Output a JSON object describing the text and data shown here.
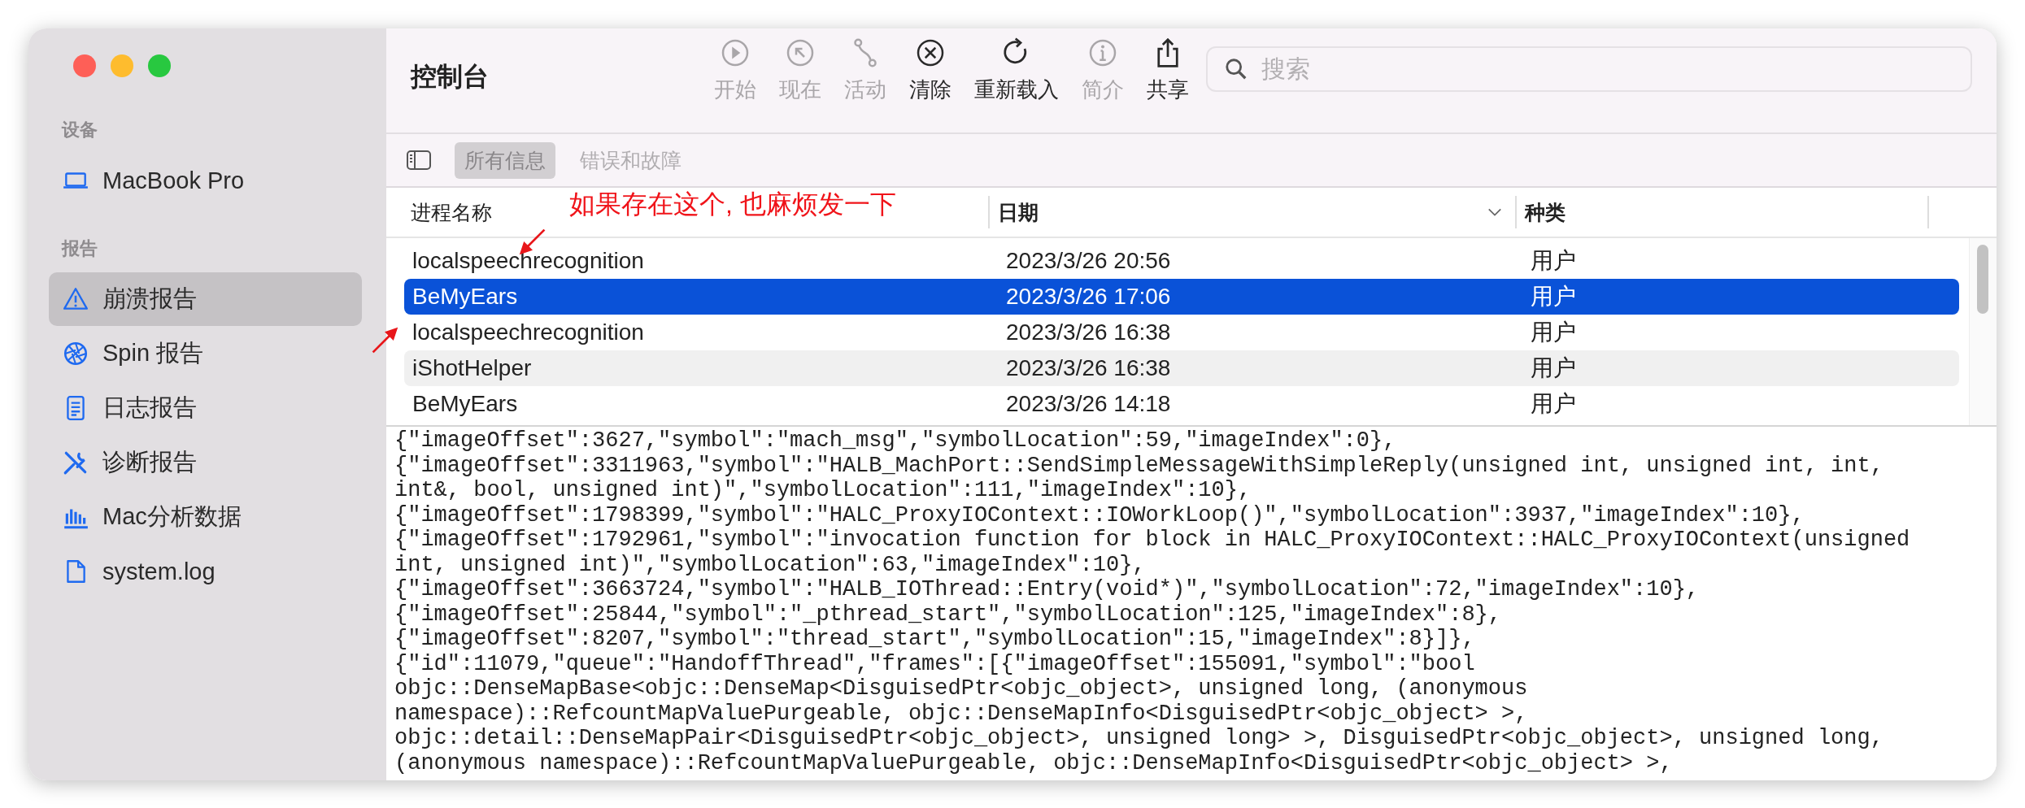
{
  "window": {
    "title": "控制台"
  },
  "sidebar": {
    "sections": [
      {
        "heading": "设备",
        "items": [
          {
            "label": "MacBook Pro",
            "kind": "laptop",
            "selected": false
          }
        ]
      },
      {
        "heading": "报告",
        "items": [
          {
            "label": "崩溃报告",
            "kind": "warning",
            "selected": true
          },
          {
            "label": "Spin 报告",
            "kind": "spin",
            "selected": false
          },
          {
            "label": "日志报告",
            "kind": "document",
            "selected": false
          },
          {
            "label": "诊断报告",
            "kind": "tools",
            "selected": false
          },
          {
            "label": "Mac分析数据",
            "kind": "chart",
            "selected": false
          },
          {
            "label": "system.log",
            "kind": "file",
            "selected": false
          }
        ]
      }
    ]
  },
  "toolbar": {
    "buttons": [
      {
        "label": "开始",
        "kind": "play",
        "disabled": true
      },
      {
        "label": "现在",
        "kind": "now",
        "disabled": true
      },
      {
        "label": "活动",
        "kind": "activity",
        "disabled": true
      },
      {
        "label": "清除",
        "kind": "clear",
        "disabled": false
      },
      {
        "label": "重新载入",
        "kind": "reload",
        "disabled": false
      },
      {
        "label": "简介",
        "kind": "info",
        "disabled": true
      },
      {
        "label": "共享",
        "kind": "share",
        "disabled": false
      }
    ],
    "search": {
      "placeholder": "搜索"
    }
  },
  "filters": [
    {
      "label": "所有信息",
      "selected": true
    },
    {
      "label": "错误和故障",
      "selected": false
    }
  ],
  "table": {
    "columns": [
      {
        "label": "进程名称",
        "sorted": false
      },
      {
        "label": "日期",
        "sorted": true
      },
      {
        "label": "种类",
        "sorted": false
      }
    ],
    "rows": [
      {
        "name": "localspeechrecognition",
        "date": "2023/3/26 20:56",
        "type": "用户",
        "selected": false
      },
      {
        "name": "BeMyEars",
        "date": "2023/3/26 17:06",
        "type": "用户",
        "selected": true
      },
      {
        "name": "localspeechrecognition",
        "date": "2023/3/26 16:38",
        "type": "用户",
        "selected": false
      },
      {
        "name": "iShotHelper",
        "date": "2023/3/26 16:38",
        "type": "用户",
        "selected": false
      },
      {
        "name": "BeMyEars",
        "date": "2023/3/26 14:18",
        "type": "用户",
        "selected": false
      }
    ]
  },
  "log": {
    "lines": [
      "{\"imageOffset\":3627,\"symbol\":\"mach_msg\",\"symbolLocation\":59,\"imageIndex\":0},",
      "{\"imageOffset\":3311963,\"symbol\":\"HALB_MachPort::SendSimpleMessageWithSimpleReply(unsigned int, unsigned int, int,",
      "int&, bool, unsigned int)\",\"symbolLocation\":111,\"imageIndex\":10},",
      "{\"imageOffset\":1798399,\"symbol\":\"HALC_ProxyIOContext::IOWorkLoop()\",\"symbolLocation\":3937,\"imageIndex\":10},",
      "{\"imageOffset\":1792961,\"symbol\":\"invocation function for block in HALC_ProxyIOContext::HALC_ProxyIOContext(unsigned",
      "int, unsigned int)\",\"symbolLocation\":63,\"imageIndex\":10},",
      "{\"imageOffset\":3663724,\"symbol\":\"HALB_IOThread::Entry(void*)\",\"symbolLocation\":72,\"imageIndex\":10},",
      "{\"imageOffset\":25844,\"symbol\":\"_pthread_start\",\"symbolLocation\":125,\"imageIndex\":8},",
      "{\"imageOffset\":8207,\"symbol\":\"thread_start\",\"symbolLocation\":15,\"imageIndex\":8}]},",
      "{\"id\":11079,\"queue\":\"HandoffThread\",\"frames\":[{\"imageOffset\":155091,\"symbol\":\"bool",
      "objc::DenseMapBase<objc::DenseMap<DisguisedPtr<objc_object>, unsigned long, (anonymous",
      "namespace)::RefcountMapValuePurgeable, objc::DenseMapInfo<DisguisedPtr<objc_object> >,",
      "objc::detail::DenseMapPair<DisguisedPtr<objc_object>, unsigned long> >, DisguisedPtr<objc_object>, unsigned long,",
      "(anonymous namespace)::RefcountMapValuePurgeable, objc::DenseMapInfo<DisguisedPtr<objc_object> >,"
    ]
  },
  "annotation": {
    "text": "如果存在这个, 也麻烦发一下"
  }
}
